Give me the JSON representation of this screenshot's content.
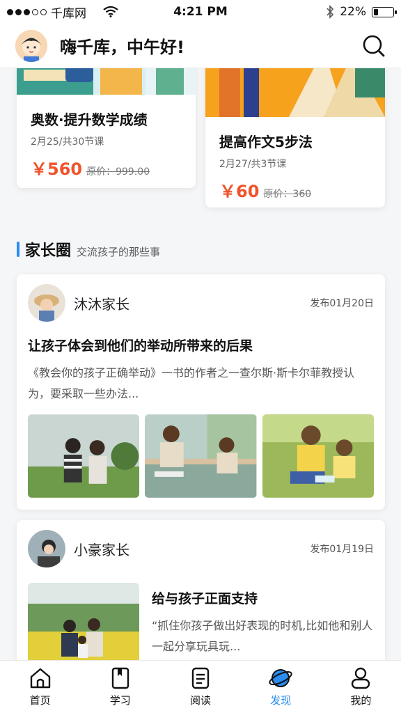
{
  "status_bar": {
    "carrier": "千库网",
    "time": "4:21 PM",
    "battery": "22%",
    "battery_level": 0.22
  },
  "header": {
    "greeting": "嗨千库，中午好!"
  },
  "courses": [
    {
      "title": "奥数·提升数学成绩",
      "meta": "2月25/共30节课",
      "price": "￥560",
      "original_price": "原价：999.00"
    },
    {
      "title": "提高作文5步法",
      "meta": "2月27/共3节课",
      "price": "￥60",
      "original_price": "原价：360"
    }
  ],
  "section": {
    "title": "家长圈",
    "subtitle": "交流孩子的那些事"
  },
  "posts": [
    {
      "author": "沐沐家长",
      "date": "发布01月20日",
      "title": "让孩子体会到他们的举动所带来的后果",
      "excerpt": "《教会你的孩子正确举动》一书的作者之一查尔斯·斯卡尔菲教授认为，要采取一些办法..."
    },
    {
      "author": "小豪家长",
      "date": "发布01月19日",
      "title": "给与孩子正面支持",
      "excerpt": "“抓住你孩子做出好表现的时机,比如他和别人一起分享玩具玩..."
    }
  ],
  "tabs": [
    {
      "label": "首页",
      "icon": "home-icon"
    },
    {
      "label": "学习",
      "icon": "book-icon"
    },
    {
      "label": "阅读",
      "icon": "reading-icon"
    },
    {
      "label": "发现",
      "icon": "discover-planet-icon",
      "active": true
    },
    {
      "label": "我的",
      "icon": "profile-icon"
    }
  ],
  "colors": {
    "accent": "#2a8cf0",
    "price": "#f0532b"
  }
}
